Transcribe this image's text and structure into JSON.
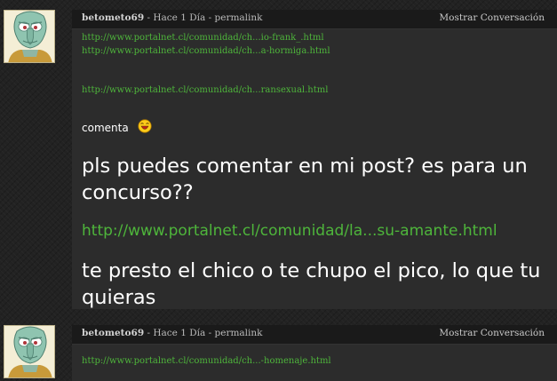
{
  "posts": [
    {
      "meta": {
        "user": "betometo69",
        "separator1": " - ",
        "time": "Hace 1 Día",
        "separator2": " - ",
        "permalink": "permalink",
        "show_conversation": "Mostrar Conversación"
      },
      "links_small": [
        "http://www.portalnet.cl/comunidad/ch...io-frank_.html",
        "http://www.portalnet.cl/comunidad/ch...a-hormiga.html",
        "http://www.portalnet.cl/comunidad/ch...ransexual.html"
      ],
      "comment_label": "comenta",
      "smiley_icon": "laughing-smiley-icon",
      "message1": "pls puedes comentar en mi post? es para un concurso??",
      "link_big": "http://www.portalnet.cl/comunidad/la...su-amante.html",
      "message2": "te presto el chico o te chupo el pico, lo que tu quieras"
    },
    {
      "meta": {
        "user": "betometo69",
        "separator1": " - ",
        "time": "Hace 1 Día",
        "separator2": " - ",
        "permalink": "permalink",
        "show_conversation": "Mostrar Conversación"
      },
      "links_small": [
        "http://www.portalnet.cl/comunidad/ch...-homenaje.html"
      ]
    }
  ]
}
